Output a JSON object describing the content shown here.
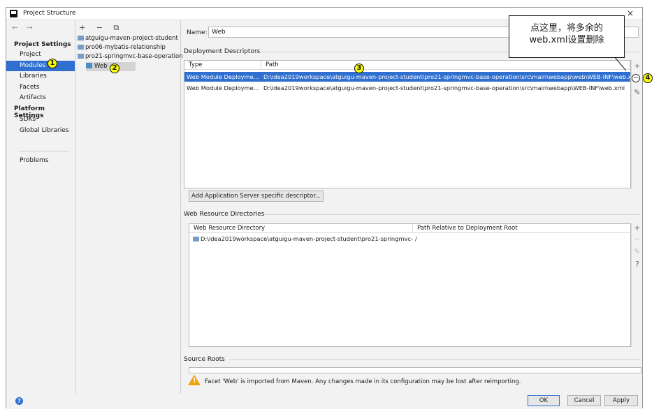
{
  "window": {
    "title": "Project Structure",
    "close": "×"
  },
  "sidebar": {
    "nav": "← →",
    "section_project_settings": "Project Settings",
    "section_platform_settings": "Platform Settings",
    "items": {
      "project": "Project",
      "modules": "Modules",
      "libraries": "Libraries",
      "facets": "Facets",
      "artifacts": "Artifacts",
      "sdks": "SDKs",
      "global_libraries": "Global Libraries",
      "problems": "Problems"
    }
  },
  "tree": {
    "tools": "+ − ⧉",
    "items": [
      "atguigu-maven-project-student",
      "pro06-mybatis-relationship",
      "pro21-springmvc-base-operation",
      "Web"
    ]
  },
  "main": {
    "name_label": "Name:",
    "name_value": "Web",
    "deployment_descriptors_title": "Deployment Descriptors",
    "dd_columns": [
      "Type",
      "Path"
    ],
    "dd_rows": [
      {
        "type": "Web Module Deployme...",
        "path": "D:\\idea2019workspace\\atguigu-maven-project-student\\pro21-springmvc-base-operation\\src\\main\\webapp\\web\\WEB-INF\\web.xml"
      },
      {
        "type": "Web Module Deployme...",
        "path": "D:\\idea2019workspace\\atguigu-maven-project-student\\pro21-springmvc-base-operation\\src\\main\\webapp\\WEB-INF\\web.xml"
      }
    ],
    "add_descriptor_button": "Add Application Server specific descriptor...",
    "web_resource_title": "Web Resource Directories",
    "wr_columns": [
      "Web Resource Directory",
      "Path Relative to Deployment Root"
    ],
    "wr_rows": [
      {
        "dir": "D:\\idea2019workspace\\atguigu-maven-project-student\\pro21-springmvc-...",
        "rel": "/"
      }
    ],
    "source_roots_title": "Source Roots",
    "warning": "Facet 'Web' is imported from Maven. Any changes made in its configuration may be lost after reimporting."
  },
  "tools": {
    "add": "+",
    "remove": "−",
    "edit": "✎",
    "help": "?"
  },
  "footer": {
    "help": "?",
    "ok": "OK",
    "cancel": "Cancel",
    "apply": "Apply"
  },
  "annotations": {
    "callout_line1": "点这里，将多余的",
    "callout_line2": "web.xml设置删除",
    "badge1": "1",
    "badge2": "2",
    "badge3": "3",
    "badge4": "4",
    "minus": "−"
  },
  "colors": {
    "selection": "#2f6fcf",
    "badge": "#ffff00",
    "warning": "#f0a30a"
  }
}
